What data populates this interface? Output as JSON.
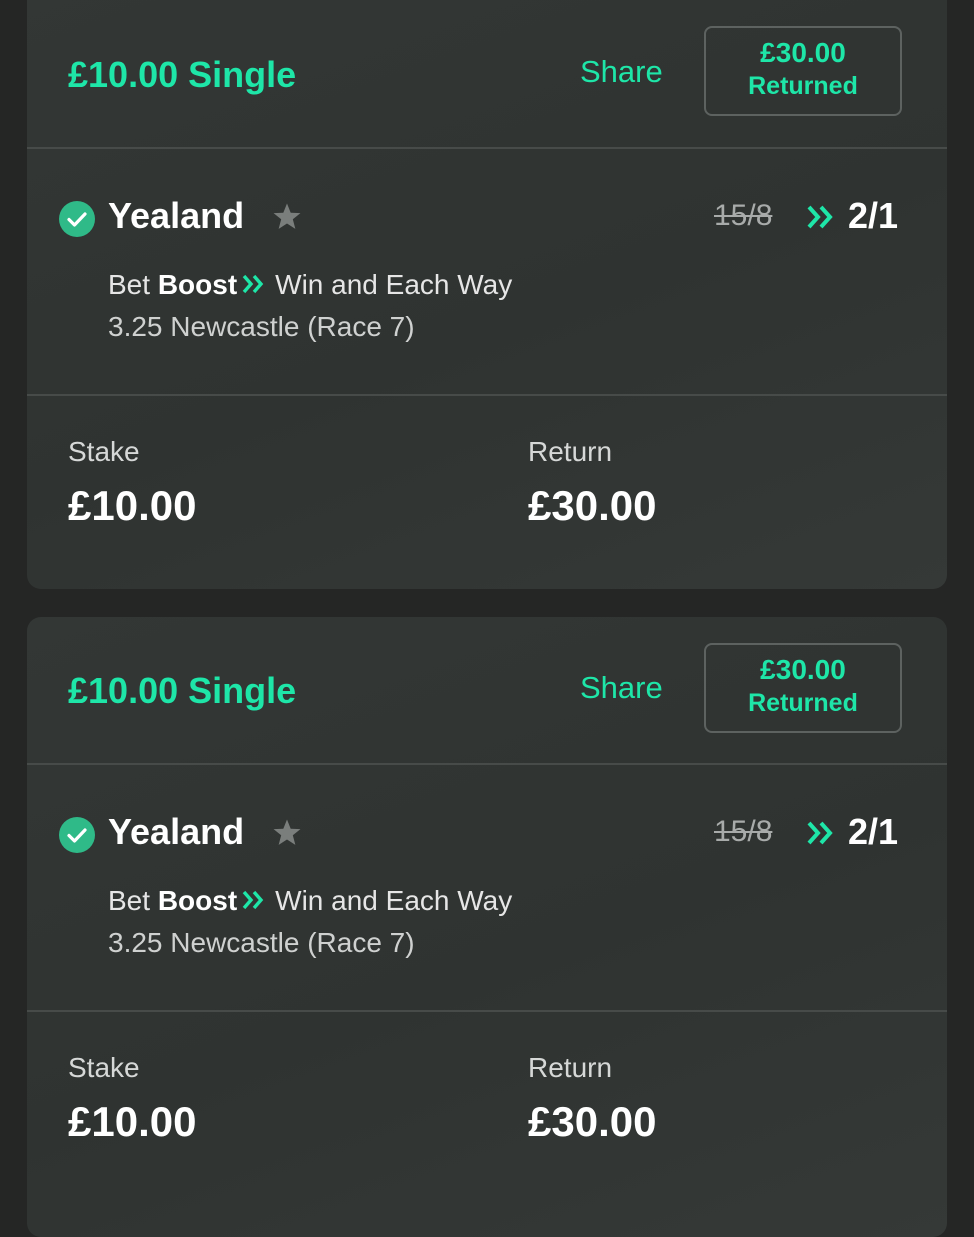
{
  "colors": {
    "accent": "#1ee6a8",
    "check_badge": "#2fba88",
    "card_background": "#323634",
    "page_background": "#252625",
    "star_inactive": "#7a7e7c"
  },
  "icons": {
    "settled": "check-circle-icon",
    "favourite": "star-icon",
    "boost": "double-chevron-right-icon"
  },
  "bets": [
    {
      "title": "£10.00 Single",
      "share_label": "Share",
      "returned_amount": "£30.00",
      "returned_label": "Returned",
      "selection": "Yealand",
      "odds_old": "15/8",
      "odds_new": "2/1",
      "market_prefix": "Bet",
      "market_boost": "Boost",
      "market_type": "Win and Each Way",
      "event": "3.25 Newcastle (Race 7)",
      "stake_label": "Stake",
      "stake_value": "£10.00",
      "return_label": "Return",
      "return_value": "£30.00"
    },
    {
      "title": "£10.00 Single",
      "share_label": "Share",
      "returned_amount": "£30.00",
      "returned_label": "Returned",
      "selection": "Yealand",
      "odds_old": "15/8",
      "odds_new": "2/1",
      "market_prefix": "Bet",
      "market_boost": "Boost",
      "market_type": "Win and Each Way",
      "event": "3.25 Newcastle (Race 7)",
      "stake_label": "Stake",
      "stake_value": "£10.00",
      "return_label": "Return",
      "return_value": "£30.00"
    }
  ]
}
